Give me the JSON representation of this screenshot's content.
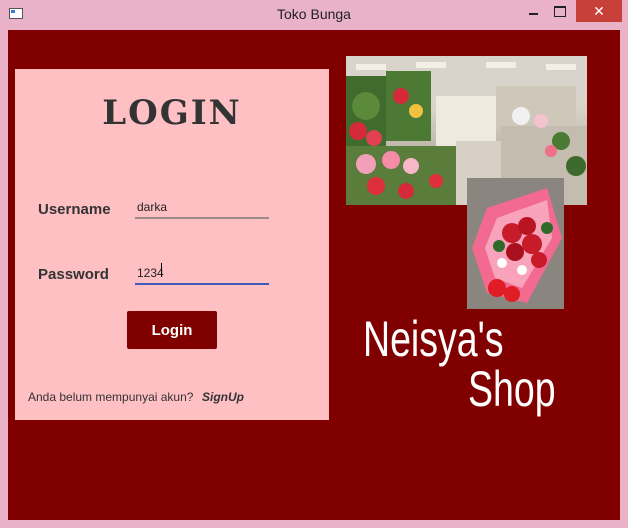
{
  "window": {
    "title": "Toko Bunga",
    "minimize_icon": "minimize-icon",
    "maximize_icon": "maximize-icon",
    "close_icon": "close-icon",
    "close_glyph": "✕",
    "background_color": "#800000"
  },
  "login": {
    "heading": "LOGIN",
    "username_label": "Username",
    "username_value": "darka",
    "password_label": "Password",
    "password_value": "1234",
    "button_label": "Login",
    "signup_prompt": "Anda belum mempunyai akun?",
    "signup_link": "SignUp",
    "panel_color": "#ffc0c4"
  },
  "brand": {
    "line1": "Neisya's",
    "line2": "Shop"
  },
  "images": {
    "shop_photo": "flower-shop-photo",
    "bouquet_photo": "red-rose-bouquet-photo"
  }
}
